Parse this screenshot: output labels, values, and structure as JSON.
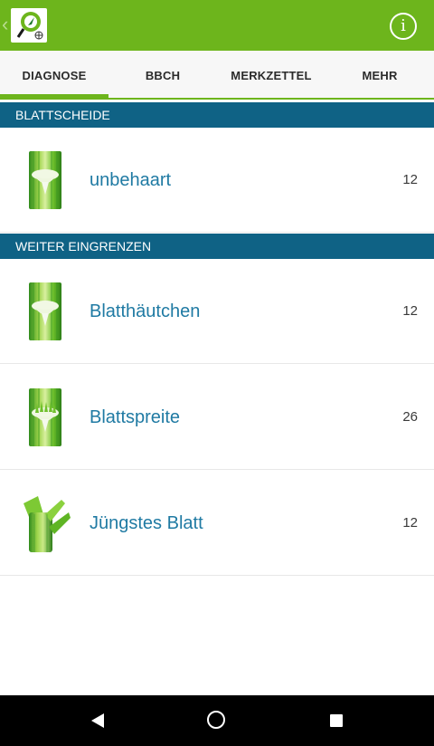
{
  "header": {
    "logo_icon": "plant-diagnosis-logo-icon",
    "info_icon": "info-icon",
    "info_glyph": "i",
    "back_glyph": "‹",
    "color": "#6db51c"
  },
  "tabs": [
    {
      "label": "DIAGNOSE",
      "active": true
    },
    {
      "label": "BBCH",
      "active": false
    },
    {
      "label": "MERKZETTEL",
      "active": false
    },
    {
      "label": "MEHR",
      "active": false
    }
  ],
  "sections": {
    "selected_title": "BLATTSCHEIDE",
    "refine_title": "WEITER EINGRENZEN",
    "header_color": "#0f6285"
  },
  "selected": {
    "label": "unbehaart",
    "count": "12",
    "icon": "leaf-sheath-hairless-icon"
  },
  "refine_items": [
    {
      "label": "Blatthäutchen",
      "count": "12",
      "icon": "ligule-icon"
    },
    {
      "label": "Blattspreite",
      "count": "26",
      "icon": "leaf-blade-icon"
    },
    {
      "label": "Jüngstes Blatt",
      "count": "12",
      "icon": "youngest-leaf-icon"
    }
  ],
  "navbar": {
    "back_icon": "nav-back-icon",
    "home_icon": "nav-home-icon",
    "recents_icon": "nav-recents-icon"
  }
}
